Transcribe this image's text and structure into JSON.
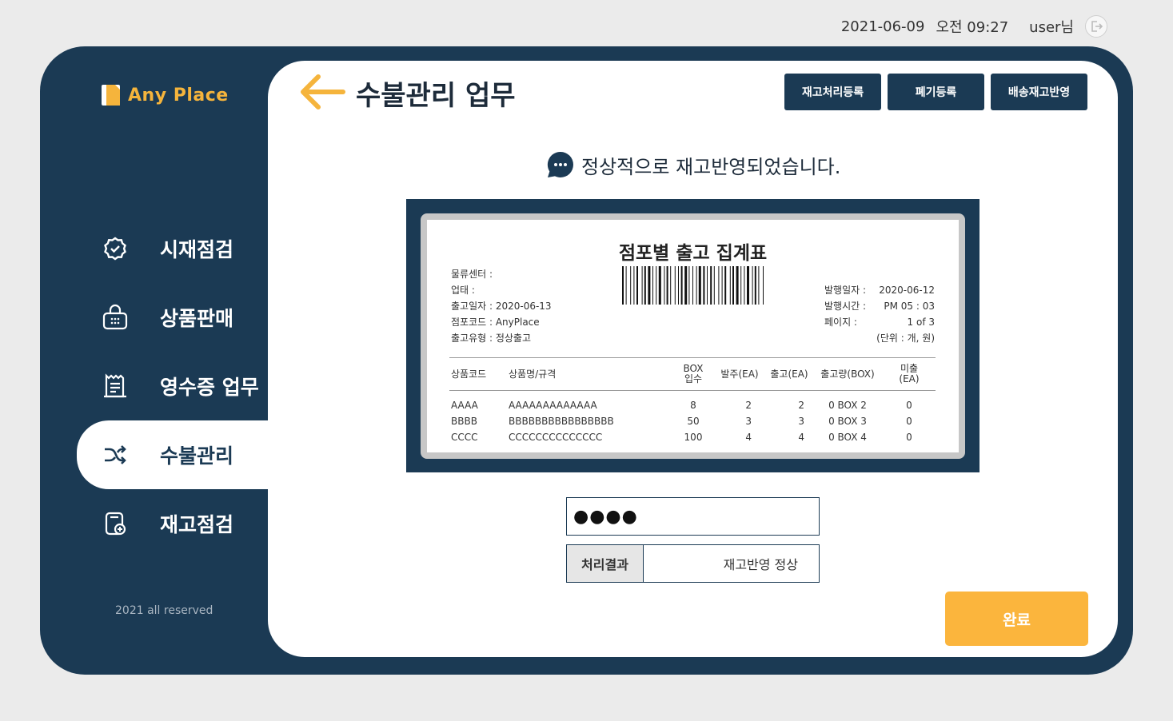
{
  "header": {
    "date": "2021-06-09",
    "time": "오전 09:27",
    "user": "user님"
  },
  "brand": {
    "name": "Any Place",
    "color": "#f5b43c"
  },
  "sidebar": {
    "items": [
      {
        "label": "시재점검",
        "icon": "check-badge-icon",
        "active": false
      },
      {
        "label": "상품판매",
        "icon": "basket-icon",
        "active": false
      },
      {
        "label": "영수증 업무",
        "icon": "receipt-icon",
        "active": false
      },
      {
        "label": "수불관리",
        "icon": "shuffle-icon",
        "active": true
      },
      {
        "label": "재고점검",
        "icon": "inventory-check-icon",
        "active": false
      }
    ],
    "copyright": "2021 all reserved"
  },
  "main": {
    "title": "수불관리 업무",
    "buttons": [
      "재고처리등록",
      "폐기등록",
      "배송재고반영"
    ],
    "message": "정상적으로 재고반영되었습니다.",
    "password_mask": "●●●●",
    "result_label": "처리결과",
    "result_value": "재고반영 정상",
    "done_label": "완료"
  },
  "receipt": {
    "title": "점포별 출고 집계표",
    "left_info": [
      "물류센터 :",
      "업태 :",
      "출고일자 : 2020-06-13",
      "점포코드 : AnyPlace",
      "출고유형 : 정상출고"
    ],
    "right_info": [
      {
        "k": "발행일자 :",
        "v": "2020-06-12"
      },
      {
        "k": "발행시간 :",
        "v": "PM 05 : 03"
      },
      {
        "k": "페이지     :",
        "v": "1 of  3"
      }
    ],
    "unit": "(단위 : 개, 원)",
    "columns": [
      "상품코드",
      "상품명/규격",
      "BOX\n입수",
      "발주(EA)",
      "출고(EA)",
      "출고량(BOX)",
      "미출\n(EA)"
    ],
    "rows": [
      [
        "AAAA",
        "AAAAAAAAAAAAA",
        "8",
        "2",
        "2",
        "0 BOX 2",
        "0"
      ],
      [
        "BBBB",
        "BBBBBBBBBBBBBBBB",
        "50",
        "3",
        "3",
        "0 BOX 3",
        "0"
      ],
      [
        "CCCC",
        "CCCCCCCCCCCCCC",
        "100",
        "4",
        "4",
        "0 BOX 4",
        "0"
      ]
    ]
  },
  "colors": {
    "navy": "#1b3a54",
    "accent": "#fbb53d",
    "background": "#ebebeb"
  }
}
